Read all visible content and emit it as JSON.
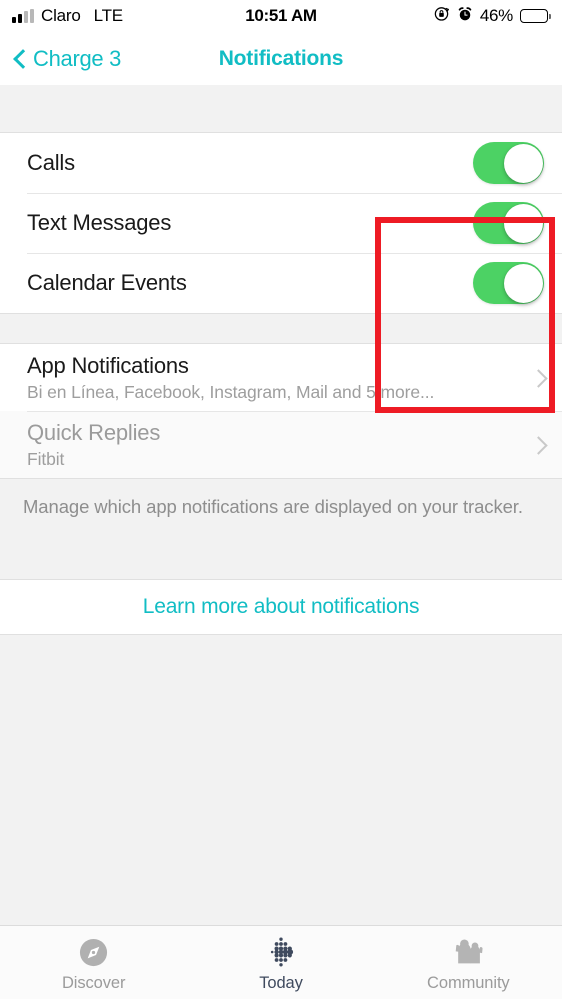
{
  "status_bar": {
    "carrier": "Claro",
    "network": "LTE",
    "time": "10:51 AM",
    "battery_percent": "46%",
    "icons": [
      "signal-bars-icon",
      "rotation-lock-icon",
      "alarm-clock-icon",
      "battery-icon"
    ]
  },
  "nav_bar": {
    "back_label": "Charge 3",
    "title": "Notifications",
    "back_icon": "chevron-left-icon",
    "accent_color": "#11bdc4"
  },
  "toggles": [
    {
      "label": "Calls",
      "on": true
    },
    {
      "label": "Text Messages",
      "on": true
    },
    {
      "label": "Calendar Events",
      "on": true
    }
  ],
  "toggle_colors": {
    "on_track": "#4cd264",
    "knob": "#ffffff"
  },
  "nav_rows": [
    {
      "title": "App Notifications",
      "subtitle": "Bi en Línea, Facebook, Instagram, Mail and 5 more...",
      "disabled": false,
      "chevron": "chevron-right-icon"
    },
    {
      "title": "Quick Replies",
      "subtitle": "Fitbit",
      "disabled": true,
      "chevron": "chevron-right-icon"
    }
  ],
  "footnote": "Manage which app notifications are displayed on your tracker.",
  "learn_more": "Learn more about notifications",
  "annotation": {
    "shape": "rectangle",
    "color": "#ee1b24",
    "target": "notification-toggles"
  },
  "tab_bar": {
    "tabs": [
      {
        "label": "Discover",
        "icon": "compass-icon",
        "active": false
      },
      {
        "label": "Today",
        "icon": "fitbit-dots-icon",
        "active": true
      },
      {
        "label": "Community",
        "icon": "people-icon",
        "active": false
      }
    ],
    "active_color": "#3f4a5e",
    "inactive_color": "#9b9b9b"
  }
}
